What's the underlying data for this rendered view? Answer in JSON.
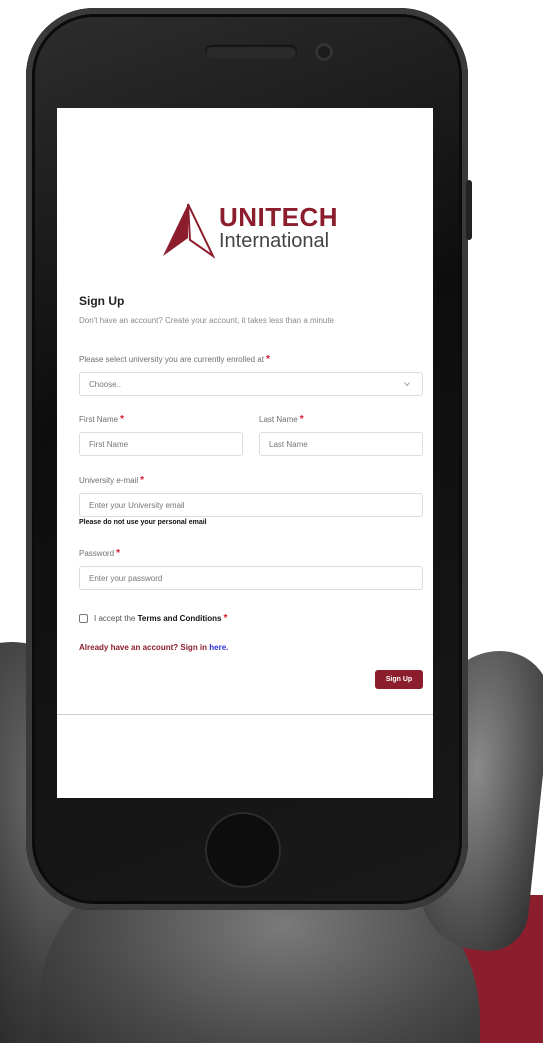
{
  "logo": {
    "line1": "UNITECH",
    "line2": "International",
    "brand_color": "#8b1d2c"
  },
  "form": {
    "title": "Sign Up",
    "subtitle": "Don't have an account? Create your account, it takes less than a minute",
    "university": {
      "label": "Please select university you are currently enrolled at",
      "selected": "Choose.."
    },
    "first_name": {
      "label": "First Name",
      "placeholder": "First Name"
    },
    "last_name": {
      "label": "Last Name",
      "placeholder": "Last Name"
    },
    "email": {
      "label": "University e-mail",
      "placeholder": "Enter your University email",
      "warning": "Please do not use your personal email"
    },
    "password": {
      "label": "Password",
      "placeholder": "Enter your password"
    },
    "terms": {
      "prefix": "I accept the",
      "link": "Terms and Conditions"
    },
    "signin": {
      "prefix": "Already have an account? Sign in",
      "link": "here."
    },
    "submit_label": "Sign Up",
    "required_mark": "*"
  },
  "colors": {
    "accent": "#8b1d2c",
    "required": "#d61a2a",
    "link": "#2b2fd6"
  },
  "icons": {
    "select_chevron": "chevron-down-icon"
  }
}
